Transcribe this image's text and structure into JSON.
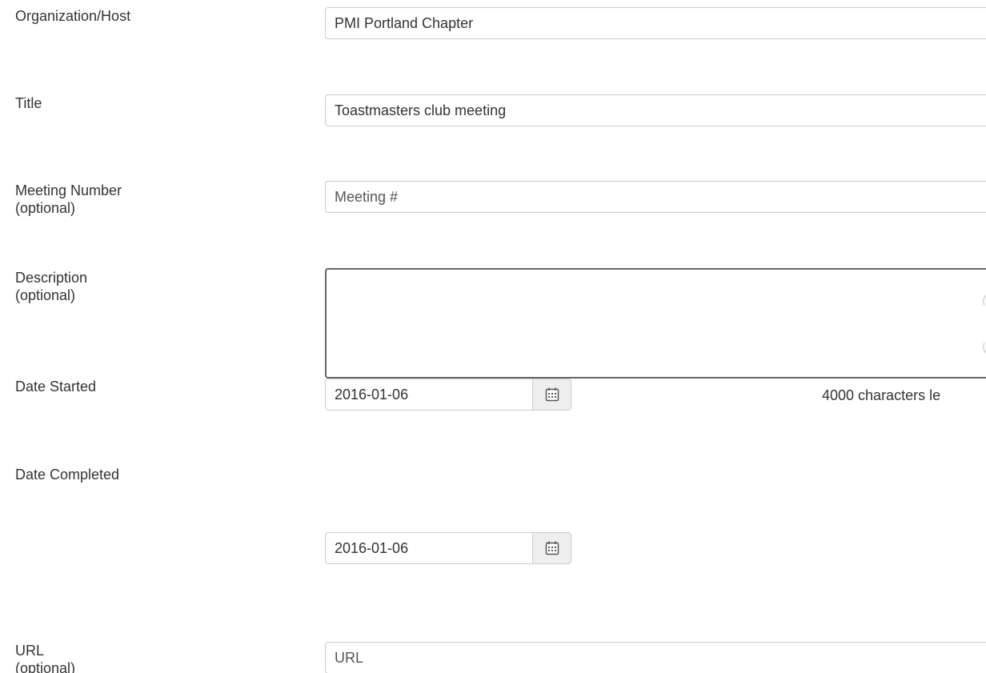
{
  "fields": {
    "organization": {
      "label": "Organization/Host",
      "value": "PMI Portland Chapter"
    },
    "title": {
      "label": "Title",
      "value": "Toastmasters club meeting"
    },
    "meeting_number": {
      "label": "Meeting Number",
      "label_note": "(optional)",
      "placeholder": "Meeting #"
    },
    "description": {
      "label": "Description",
      "label_note": "(optional)",
      "value": "",
      "counter_text": "4000 characters le"
    },
    "date_started": {
      "label": "Date Started",
      "value": "2016-01-06",
      "icon": "calendar-icon"
    },
    "date_completed": {
      "label": "Date Completed",
      "value": "2016-01-06",
      "icon": "calendar-icon"
    },
    "url": {
      "label": "URL",
      "label_note": "(optional)",
      "placeholder": "URL"
    }
  }
}
